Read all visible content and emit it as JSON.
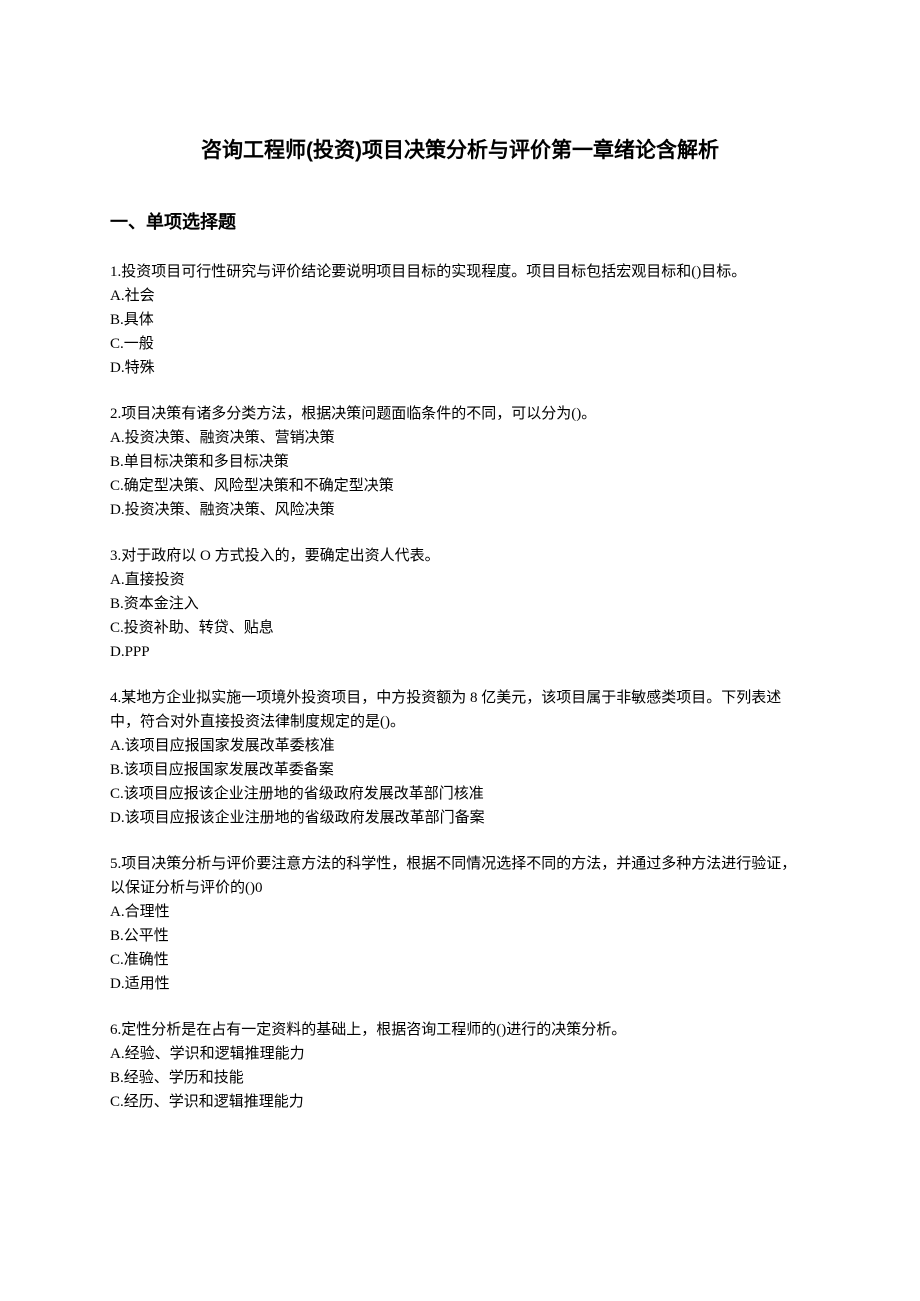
{
  "title": "咨询工程师(投资)项目决策分析与评价第一章绪论含解析",
  "section1": {
    "heading": "一、单项选择题",
    "questions": [
      {
        "stem": "1.投资项目可行性研究与评价结论要说明项目目标的实现程度。项目目标包括宏观目标和()目标。",
        "opts": [
          "A.社会",
          "B.具体",
          "C.一般",
          "D.特殊"
        ]
      },
      {
        "stem": "2.项目决策有诸多分类方法，根据决策问题面临条件的不同，可以分为()。",
        "opts": [
          "A.投资决策、融资决策、营销决策",
          "B.单目标决策和多目标决策",
          "C.确定型决策、风险型决策和不确定型决策",
          "D.投资决策、融资决策、风险决策"
        ]
      },
      {
        "stem": "3.对于政府以 O 方式投入的，要确定出资人代表。",
        "opts": [
          "A.直接投资",
          "B.资本金注入",
          "C.投资补助、转贷、贴息",
          "D.PPP"
        ]
      },
      {
        "stem": "4.某地方企业拟实施一项境外投资项目，中方投资额为 8 亿美元，该项目属于非敏感类项目。下列表述中，符合对外直接投资法律制度规定的是()。",
        "opts": [
          "A.该项目应报国家发展改革委核准",
          "B.该项目应报国家发展改革委备案",
          "C.该项目应报该企业注册地的省级政府发展改革部门核准",
          "D.该项目应报该企业注册地的省级政府发展改革部门备案"
        ]
      },
      {
        "stem": "5.项目决策分析与评价要注意方法的科学性，根据不同情况选择不同的方法，并通过多种方法进行验证，以保证分析与评价的()0",
        "opts": [
          "A.合理性",
          "B.公平性",
          "C.准确性",
          "D.适用性"
        ]
      },
      {
        "stem": "6.定性分析是在占有一定资料的基础上，根据咨询工程师的()进行的决策分析。",
        "opts": [
          "A.经验、学识和逻辑推理能力",
          "B.经验、学历和技能",
          "C.经历、学识和逻辑推理能力"
        ]
      }
    ]
  }
}
